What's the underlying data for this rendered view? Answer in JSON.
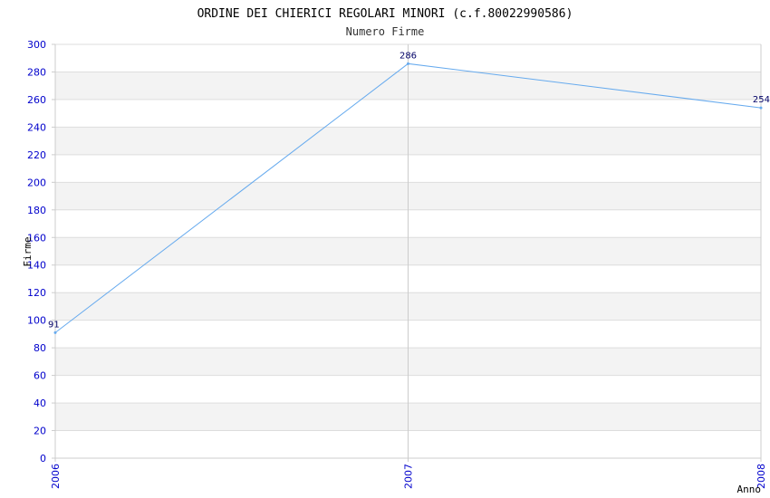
{
  "chart_data": {
    "type": "line",
    "title": "ORDINE DEI CHIERICI REGOLARI MINORI (c.f.80022990586)",
    "subtitle": "Numero Firme",
    "xlabel": "Anno",
    "ylabel": "Firme",
    "categories": [
      "2006",
      "2007",
      "2008"
    ],
    "series": [
      {
        "values": [
          91,
          286,
          254
        ]
      }
    ],
    "ylim": [
      0,
      300
    ],
    "ytick_step": 20,
    "grid": true,
    "colors": {
      "line": "#66aaee",
      "band": "#f3f3f3",
      "grid": "#dddddd",
      "axis": "#cccccc",
      "tick_text": "#0000cc"
    }
  }
}
